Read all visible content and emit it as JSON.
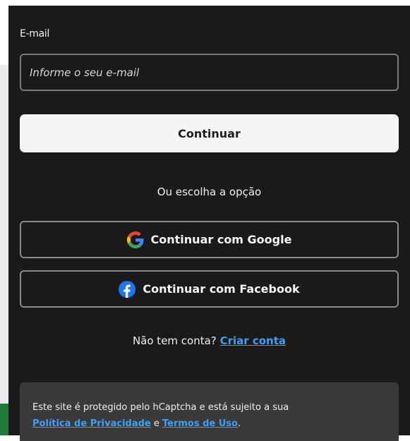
{
  "form": {
    "email_label": "E-mail",
    "email_placeholder": "Informe o seu e-mail",
    "email_value": "",
    "continue_label": "Continuar",
    "divider_text": "Ou escolha a opção"
  },
  "social": {
    "google_label": "Continuar com Google",
    "google_icon": "google-icon",
    "facebook_label": "Continuar com Facebook",
    "facebook_icon": "facebook-icon"
  },
  "signup": {
    "prompt": "Não tem conta?",
    "link_label": "Criar conta"
  },
  "captcha_notice": {
    "text": "Este site é protegido pelo hCaptcha e está sujeito a sua",
    "privacy_link": "Política de Privacidade",
    "conjunction": "e",
    "terms_link": "Termos de Uso",
    "end": "."
  },
  "colors": {
    "panel_bg": "#1a1a1a",
    "link": "#3aa0ff",
    "primary_button_bg": "#f5f5f5",
    "notice_bg": "#3a3a3a"
  }
}
